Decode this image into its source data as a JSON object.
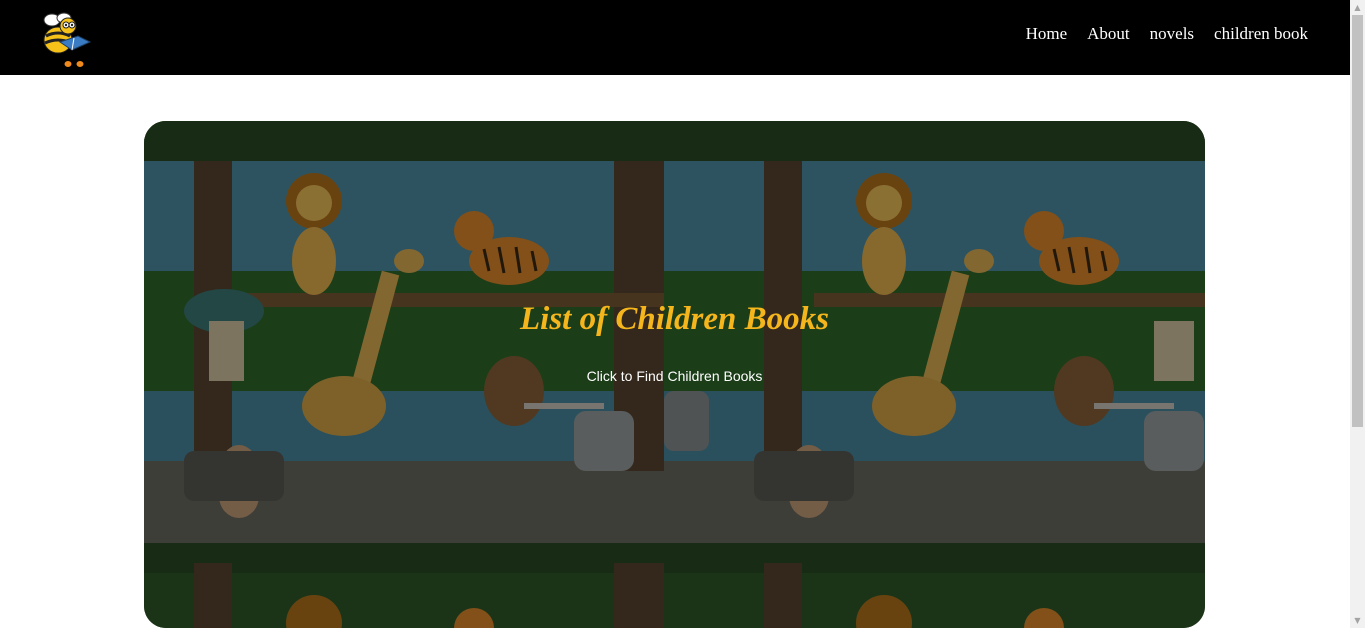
{
  "header": {
    "logo_icon": "bee-reading-book-logo",
    "nav": [
      {
        "label": "Home"
      },
      {
        "label": "About"
      },
      {
        "label": "novels"
      },
      {
        "label": "children book"
      }
    ]
  },
  "hero": {
    "title": "List of Children Books",
    "link_label": "Click to Find Children Books",
    "background_image": "jungle-nursery-mural-with-lion-tiger-giraffe",
    "title_color": "#f5b51c"
  },
  "colors": {
    "header_bg": "#000000",
    "page_bg": "#ffffff"
  }
}
